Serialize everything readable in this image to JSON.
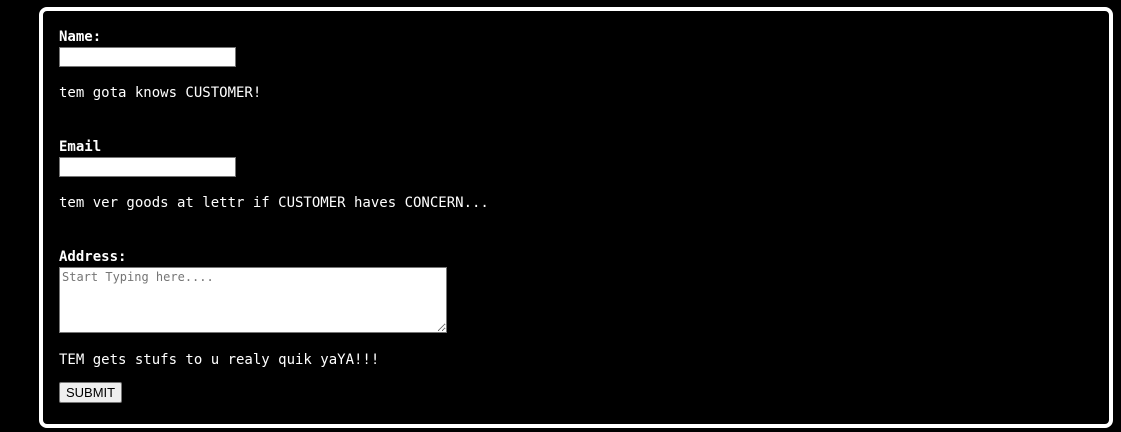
{
  "form": {
    "name": {
      "label": "Name:",
      "value": "",
      "tagline": "tem gota knows CUSTOMER!"
    },
    "email": {
      "label": "Email",
      "value": "",
      "tagline": "tem ver goods at lettr if CUSTOMER haves CONCERN..."
    },
    "address": {
      "label": "Address:",
      "placeholder": "Start Typing here....",
      "tagline": "TEM gets stufs to u realy quik yaYA!!!"
    },
    "submit_label": "SUBMIT"
  },
  "colors": {
    "background": "#000000",
    "border": "#ffffff",
    "text": "#ffffff"
  }
}
